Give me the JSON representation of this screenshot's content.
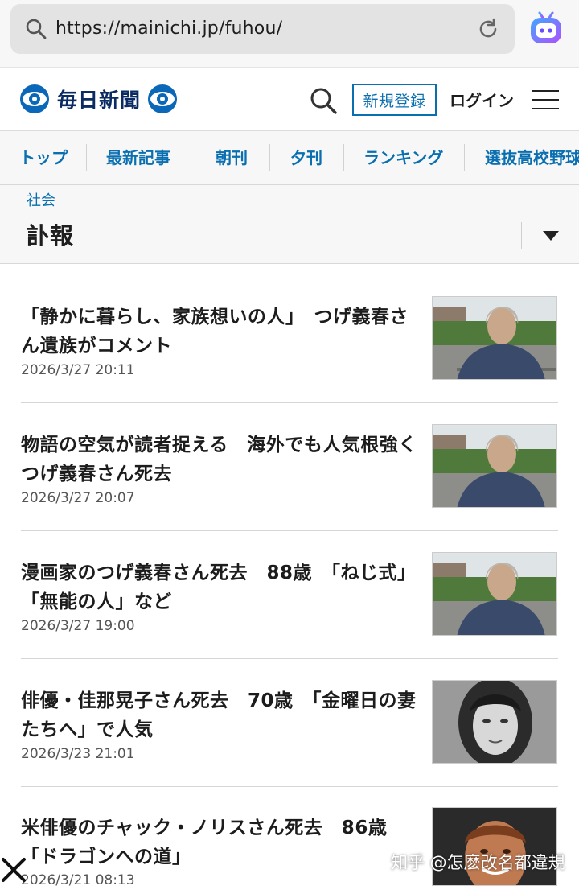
{
  "browser": {
    "url": "https://mainichi.jp/fuhou/",
    "icons": [
      "search-icon",
      "reload-icon",
      "extension-bot-icon"
    ]
  },
  "site_header": {
    "logo_text": "毎日新聞",
    "register_label": "新規登録",
    "login_label": "ログイン",
    "icons": [
      "search-icon",
      "menu-icon"
    ]
  },
  "nav": {
    "items": [
      "トップ",
      "最新記事",
      "朝刊",
      "夕刊",
      "ランキング",
      "選抜高校野球"
    ]
  },
  "category": {
    "label": "社会",
    "title": "訃報"
  },
  "articles": [
    {
      "title": "「静かに暮らし、家族想いの人」　つげ義春さん遺族がコメント",
      "date": "2026/3/27 20:11",
      "thumb": "portrait-elderly-man"
    },
    {
      "title": "物語の空気が読者捉える　海外でも人気根強く　つげ義春さん死去",
      "date": "2026/3/27 20:07",
      "thumb": "portrait-elderly-man"
    },
    {
      "title": "漫画家のつげ義春さん死去　88歳　「ねじ式」「無能の人」など",
      "date": "2026/3/27 19:00",
      "thumb": "portrait-elderly-man"
    },
    {
      "title": "俳優・佳那晃子さん死去　70歳　「金曜日の妻たちへ」で人気",
      "date": "2026/3/23 21:01",
      "thumb": "portrait-woman-bw"
    },
    {
      "title": "米俳優のチャック・ノリスさん死去　86歳　「ドラゴンへの道」",
      "date": "2026/3/21 08:13",
      "thumb": "portrait-man-smiling"
    }
  ],
  "overlay": {
    "watermark": "知乎 @怎麽改名都違規"
  },
  "colors": {
    "accent_blue": "#0a6fb0",
    "logo_navy": "#0b2c63",
    "nav_background": "#f7f7f7"
  }
}
